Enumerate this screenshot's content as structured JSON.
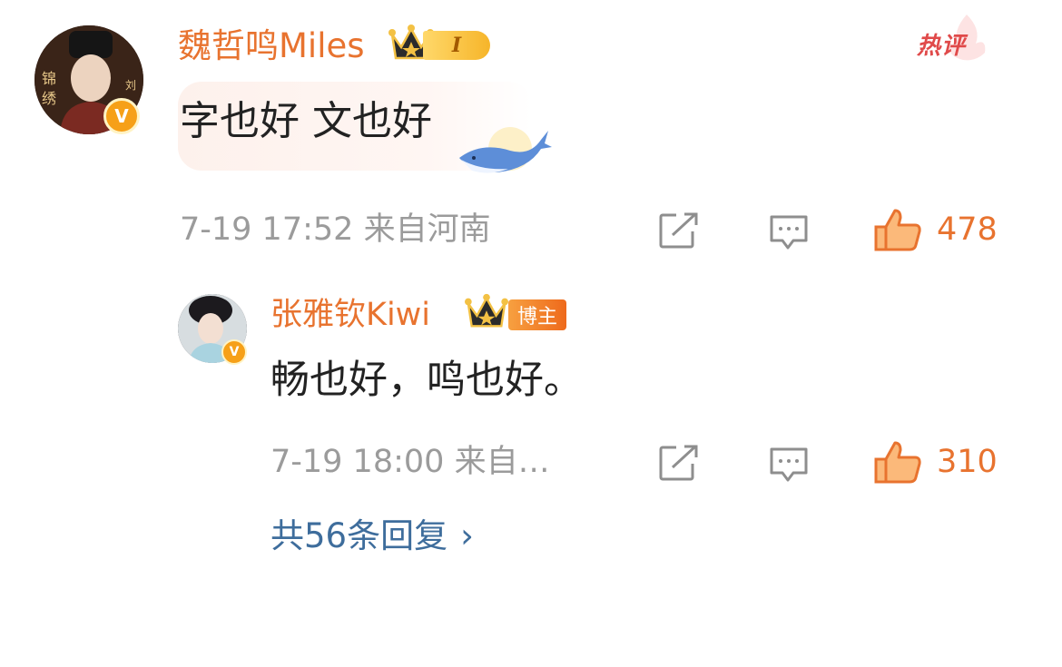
{
  "comment": {
    "username": "魏哲鸣Miles",
    "level_badge": "I",
    "hot_tag": "热评",
    "text": "字也好 文也好",
    "timestamp": "7-19 17:52",
    "location": "来自河南",
    "like_count": "478",
    "avatar_icon": "user-avatar",
    "verified_icon": "verified-v-icon",
    "verified_label": "V",
    "decoration_icon": "whale-sticker-icon"
  },
  "reply": {
    "username": "张雅钦Kiwi",
    "role_badge": "博主",
    "text": "畅也好，鸣也好。",
    "timestamp": "7-19 18:00",
    "location": "来自…",
    "like_count": "310",
    "verified_label": "V"
  },
  "replies_link": {
    "label": "共56条回复",
    "arrow": "›"
  },
  "icons": {
    "share": "share-icon",
    "comment": "comment-icon",
    "like": "thumbs-up-icon",
    "crown": "crown-icon"
  },
  "colors": {
    "username": "#e8732f",
    "like": "#e8732f",
    "meta": "#9b9b9b",
    "link": "#3e6d9c",
    "verified": "#f6a018",
    "hot_tag": "#e04a4a",
    "blogger_tag": "#ee6a1c"
  }
}
